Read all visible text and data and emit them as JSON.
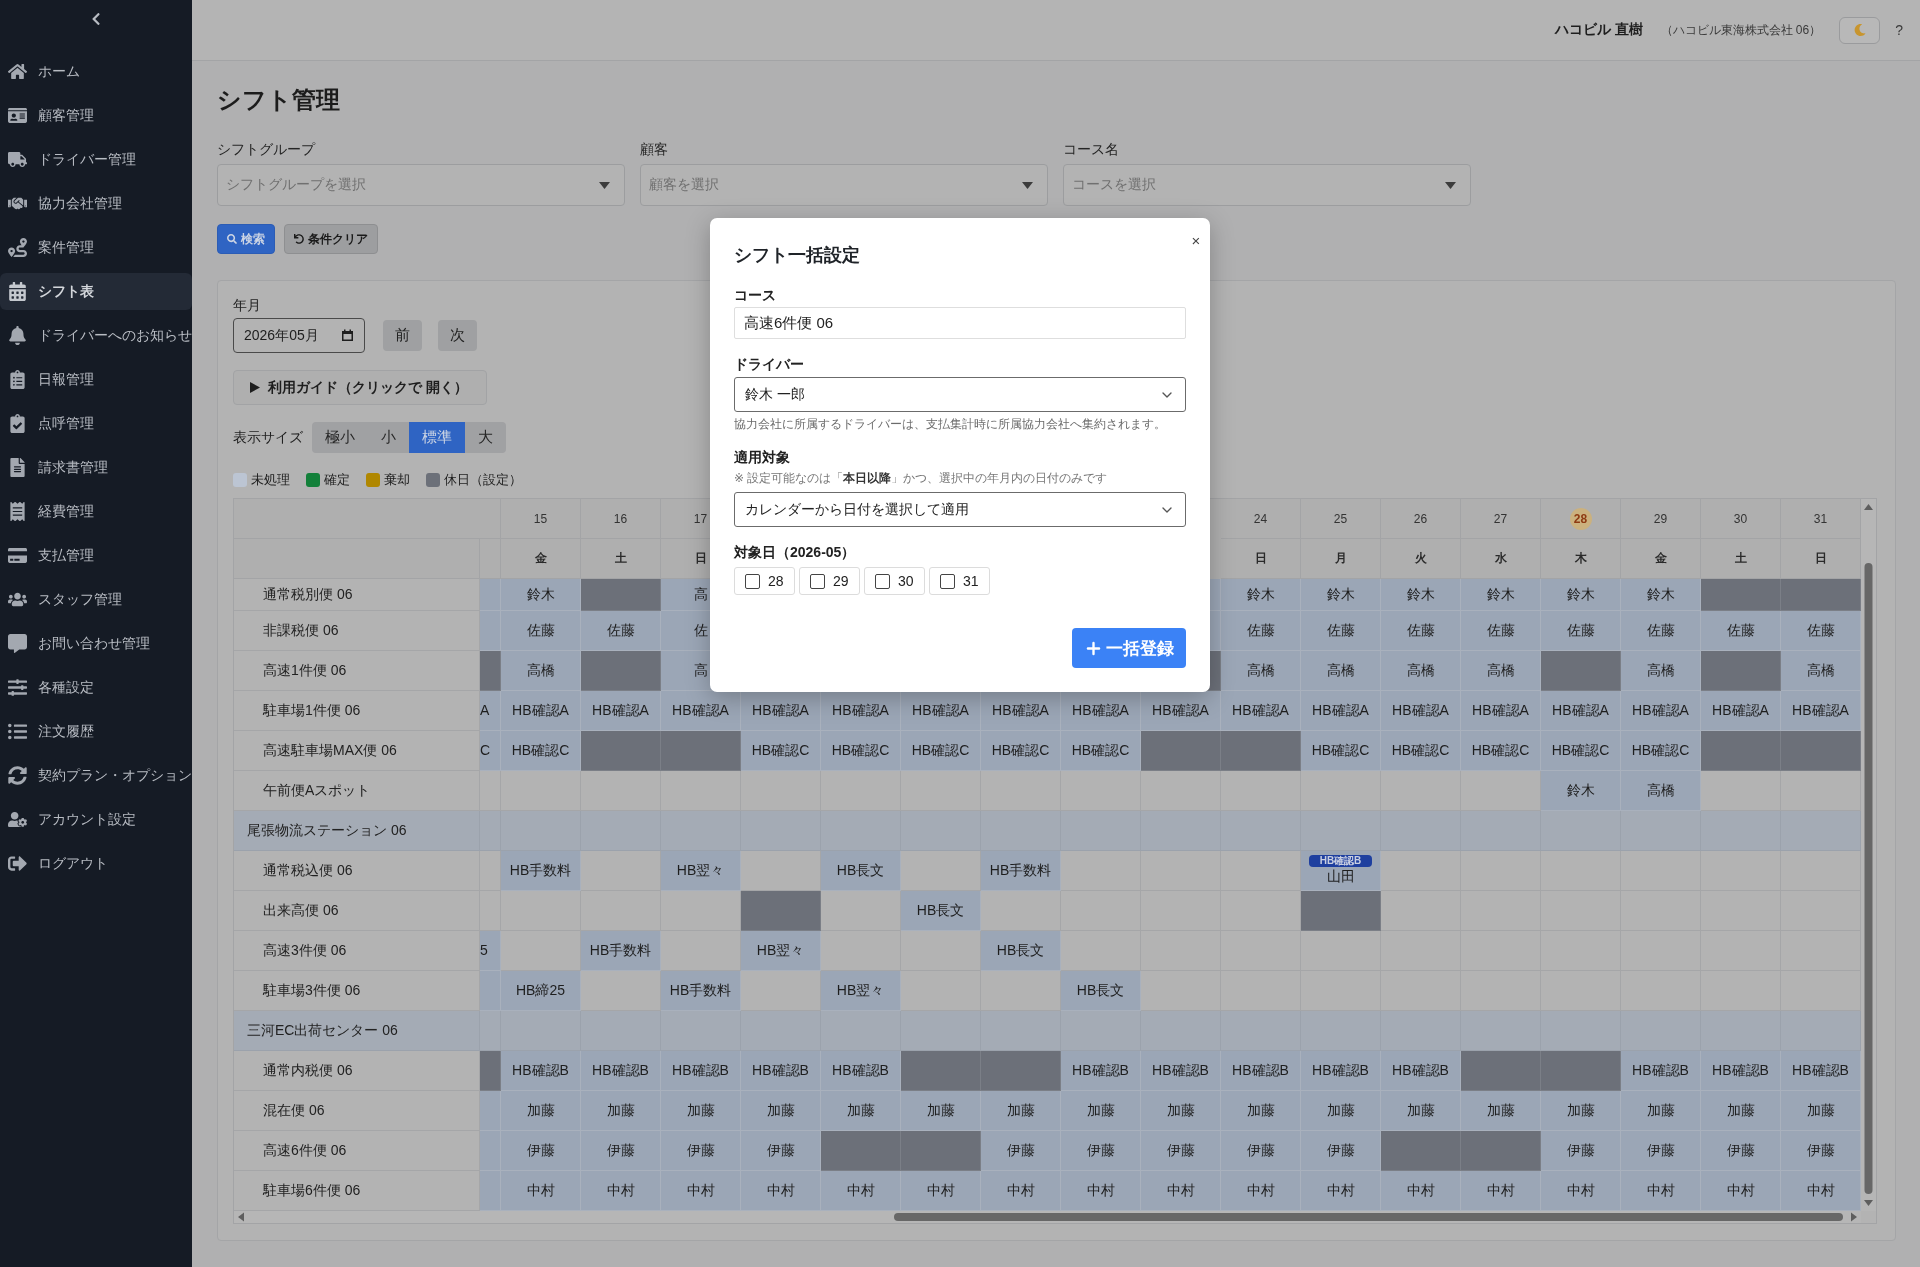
{
  "sidebar": {
    "items": [
      {
        "label": "ホーム",
        "selected": false
      },
      {
        "label": "顧客管理",
        "selected": false
      },
      {
        "label": "ドライバー管理",
        "selected": false
      },
      {
        "label": "協力会社管理",
        "selected": false
      },
      {
        "label": "案件管理",
        "selected": false
      },
      {
        "label": "シフト表",
        "selected": true
      },
      {
        "label": "ドライバーへのお知らせ",
        "selected": false
      },
      {
        "label": "日報管理",
        "selected": false
      },
      {
        "label": "点呼管理",
        "selected": false
      },
      {
        "label": "請求書管理",
        "selected": false
      },
      {
        "label": "経費管理",
        "selected": false
      },
      {
        "label": "支払管理",
        "selected": false
      },
      {
        "label": "スタッフ管理",
        "selected": false
      },
      {
        "label": "お問い合わせ管理",
        "selected": false
      },
      {
        "label": "各種設定",
        "selected": false
      },
      {
        "label": "注文履歴",
        "selected": false
      },
      {
        "label": "契約プラン・オプション",
        "selected": false
      },
      {
        "label": "アカウント設定",
        "selected": false
      },
      {
        "label": "ログアウト",
        "selected": false
      }
    ]
  },
  "topbar": {
    "user_name": "ハコビル 直樹",
    "company": "（ハコビル東海株式会社 06）",
    "help": "?"
  },
  "page": {
    "title": "シフト管理"
  },
  "filters": [
    {
      "label": "シフトグループ",
      "placeholder": "シフトグループを選択"
    },
    {
      "label": "顧客",
      "placeholder": "顧客を選択"
    },
    {
      "label": "コース名",
      "placeholder": "コースを選択"
    }
  ],
  "actions": [
    {
      "label": "検索",
      "kind": "primary"
    },
    {
      "label": "条件クリア",
      "kind": "secondary"
    }
  ],
  "month": {
    "label": "年月",
    "value": "2026年05月",
    "prev": "前",
    "next": "次"
  },
  "guide": {
    "label": "利用ガイド（クリックで 開く）",
    "expanded": false
  },
  "size": {
    "label": "表示サイズ",
    "options": [
      {
        "label": "極小",
        "selected": false
      },
      {
        "label": "小",
        "selected": false
      },
      {
        "label": "標準",
        "selected": true
      },
      {
        "label": "大",
        "selected": false
      }
    ]
  },
  "legend": [
    {
      "label": "未処理",
      "color": "#bcc5d3"
    },
    {
      "label": "確定",
      "color": "#13803a"
    },
    {
      "label": "棄却",
      "color": "#b08700"
    },
    {
      "label": "休日（設定）",
      "color": "#6c7079"
    }
  ],
  "table": {
    "days": [
      {
        "kind": "partial"
      },
      {
        "kind": "day",
        "day": "15",
        "weekday": "金",
        "today": false
      },
      {
        "kind": "day",
        "day": "16",
        "weekday": "土",
        "today": false
      },
      {
        "kind": "day",
        "day": "17",
        "weekday": "日",
        "today": false
      },
      {
        "kind": "covered"
      },
      {
        "kind": "covered"
      },
      {
        "kind": "covered"
      },
      {
        "kind": "covered"
      },
      {
        "kind": "covered"
      },
      {
        "kind": "covered"
      },
      {
        "kind": "day",
        "day": "24",
        "weekday": "日",
        "today": false
      },
      {
        "kind": "day",
        "day": "25",
        "weekday": "月",
        "today": false
      },
      {
        "kind": "day",
        "day": "26",
        "weekday": "火",
        "today": false
      },
      {
        "kind": "day",
        "day": "27",
        "weekday": "水",
        "today": false
      },
      {
        "kind": "day",
        "day": "28",
        "weekday": "木",
        "today": true
      },
      {
        "kind": "day",
        "day": "29",
        "weekday": "金",
        "today": false
      },
      {
        "kind": "day",
        "day": "30",
        "weekday": "土",
        "today": false
      },
      {
        "kind": "day",
        "day": "31",
        "weekday": "日",
        "today": false
      }
    ],
    "rows": [
      {
        "kind": "course",
        "label": "通常税別便 06",
        "cells": [
          {
            "kind": "pending"
          },
          {
            "kind": "pending",
            "text": "鈴木"
          },
          {
            "kind": "holiday"
          },
          {
            "kind": "pending",
            "text": "高"
          },
          {
            "kind": "covered"
          },
          {
            "kind": "covered"
          },
          {
            "kind": "covered"
          },
          {
            "kind": "covered"
          },
          {
            "kind": "covered"
          },
          {
            "kind": "pending"
          },
          {
            "kind": "pending",
            "text": "鈴木"
          },
          {
            "kind": "pending",
            "text": "鈴木"
          },
          {
            "kind": "pending",
            "text": "鈴木"
          },
          {
            "kind": "pending",
            "text": "鈴木"
          },
          {
            "kind": "pending",
            "text": "鈴木"
          },
          {
            "kind": "pending",
            "text": "鈴木"
          },
          {
            "kind": "holiday"
          },
          {
            "kind": "holiday"
          }
        ]
      },
      {
        "kind": "course",
        "label": "非課税便 06",
        "cells": [
          {
            "kind": "pending"
          },
          {
            "kind": "pending",
            "text": "佐藤"
          },
          {
            "kind": "pending",
            "text": "佐藤"
          },
          {
            "kind": "pending",
            "text": "佐"
          },
          {
            "kind": "covered"
          },
          {
            "kind": "covered"
          },
          {
            "kind": "covered"
          },
          {
            "kind": "covered"
          },
          {
            "kind": "covered"
          },
          {
            "kind": "pending"
          },
          {
            "kind": "pending",
            "text": "佐藤"
          },
          {
            "kind": "pending",
            "text": "佐藤"
          },
          {
            "kind": "pending",
            "text": "佐藤"
          },
          {
            "kind": "pending",
            "text": "佐藤"
          },
          {
            "kind": "pending",
            "text": "佐藤"
          },
          {
            "kind": "pending",
            "text": "佐藤"
          },
          {
            "kind": "pending",
            "text": "佐藤"
          },
          {
            "kind": "pending",
            "text": "佐藤"
          }
        ]
      },
      {
        "kind": "course",
        "label": "高速1件便 06",
        "cells": [
          {
            "kind": "holiday"
          },
          {
            "kind": "pending",
            "text": "高橋"
          },
          {
            "kind": "holiday"
          },
          {
            "kind": "pending",
            "text": "高"
          },
          {
            "kind": "covered"
          },
          {
            "kind": "covered"
          },
          {
            "kind": "covered"
          },
          {
            "kind": "covered"
          },
          {
            "kind": "covered"
          },
          {
            "kind": "holiday"
          },
          {
            "kind": "pending",
            "text": "高橋"
          },
          {
            "kind": "pending",
            "text": "高橋"
          },
          {
            "kind": "pending",
            "text": "高橋"
          },
          {
            "kind": "pending",
            "text": "高橋"
          },
          {
            "kind": "holiday"
          },
          {
            "kind": "pending",
            "text": "高橋"
          },
          {
            "kind": "holiday"
          },
          {
            "kind": "pending",
            "text": "高橋"
          }
        ]
      },
      {
        "kind": "course",
        "label": "駐車場1件便 06",
        "cells": [
          {
            "kind": "pending",
            "text": "A"
          },
          {
            "kind": "pending",
            "text": "HB確認A"
          },
          {
            "kind": "pending",
            "text": "HB確認A"
          },
          {
            "kind": "pending",
            "text": "HB確認A"
          },
          {
            "kind": "pending",
            "text": "HB確認A"
          },
          {
            "kind": "pending",
            "text": "HB確認A"
          },
          {
            "kind": "pending",
            "text": "HB確認A"
          },
          {
            "kind": "pending",
            "text": "HB確認A"
          },
          {
            "kind": "pending",
            "text": "HB確認A"
          },
          {
            "kind": "pending",
            "text": "HB確認A"
          },
          {
            "kind": "pending",
            "text": "HB確認A"
          },
          {
            "kind": "pending",
            "text": "HB確認A"
          },
          {
            "kind": "pending",
            "text": "HB確認A"
          },
          {
            "kind": "pending",
            "text": "HB確認A"
          },
          {
            "kind": "pending",
            "text": "HB確認A"
          },
          {
            "kind": "pending",
            "text": "HB確認A"
          },
          {
            "kind": "pending",
            "text": "HB確認A"
          },
          {
            "kind": "pending",
            "text": "HB確認A"
          }
        ]
      },
      {
        "kind": "course",
        "label": "高速駐車場MAX便 06",
        "cells": [
          {
            "kind": "pending",
            "text": "C"
          },
          {
            "kind": "pending",
            "text": "HB確認C"
          },
          {
            "kind": "holiday"
          },
          {
            "kind": "holiday"
          },
          {
            "kind": "pending",
            "text": "HB確認C"
          },
          {
            "kind": "pending",
            "text": "HB確認C"
          },
          {
            "kind": "pending",
            "text": "HB確認C"
          },
          {
            "kind": "pending",
            "text": "HB確認C"
          },
          {
            "kind": "pending",
            "text": "HB確認C"
          },
          {
            "kind": "holiday"
          },
          {
            "kind": "holiday"
          },
          {
            "kind": "pending",
            "text": "HB確認C"
          },
          {
            "kind": "pending",
            "text": "HB確認C"
          },
          {
            "kind": "pending",
            "text": "HB確認C"
          },
          {
            "kind": "pending",
            "text": "HB確認C"
          },
          {
            "kind": "pending",
            "text": "HB確認C"
          },
          {
            "kind": "holiday"
          },
          {
            "kind": "holiday"
          }
        ]
      },
      {
        "kind": "course",
        "label": "午前便Aスポット",
        "cells": [
          {
            "kind": "empty"
          },
          {
            "kind": "empty"
          },
          {
            "kind": "empty"
          },
          {
            "kind": "empty"
          },
          {
            "kind": "empty"
          },
          {
            "kind": "empty"
          },
          {
            "kind": "empty"
          },
          {
            "kind": "empty"
          },
          {
            "kind": "empty"
          },
          {
            "kind": "empty"
          },
          {
            "kind": "empty"
          },
          {
            "kind": "empty"
          },
          {
            "kind": "empty"
          },
          {
            "kind": "empty"
          },
          {
            "kind": "pending",
            "text": "鈴木"
          },
          {
            "kind": "pending",
            "text": "高橋"
          },
          {
            "kind": "empty"
          },
          {
            "kind": "empty"
          }
        ]
      },
      {
        "kind": "group",
        "label": "尾張物流ステーション 06"
      },
      {
        "kind": "course",
        "label": "通常税込便 06",
        "cells": [
          {
            "kind": "empty"
          },
          {
            "kind": "pending",
            "text": "HB手数料"
          },
          {
            "kind": "empty"
          },
          {
            "kind": "pending",
            "text": "HB翌々"
          },
          {
            "kind": "empty"
          },
          {
            "kind": "pending",
            "text": "HB長文"
          },
          {
            "kind": "empty"
          },
          {
            "kind": "pending",
            "text": "HB手数料"
          },
          {
            "kind": "empty"
          },
          {
            "kind": "empty"
          },
          {
            "kind": "empty"
          },
          {
            "kind": "pending",
            "tag": "HB確認B",
            "text": "山田"
          },
          {
            "kind": "empty"
          },
          {
            "kind": "empty"
          },
          {
            "kind": "empty"
          },
          {
            "kind": "empty"
          },
          {
            "kind": "empty"
          },
          {
            "kind": "empty"
          }
        ]
      },
      {
        "kind": "course",
        "label": "出来高便 06",
        "cells": [
          {
            "kind": "empty"
          },
          {
            "kind": "empty"
          },
          {
            "kind": "empty"
          },
          {
            "kind": "empty"
          },
          {
            "kind": "holiday"
          },
          {
            "kind": "empty"
          },
          {
            "kind": "pending",
            "text": "HB長文"
          },
          {
            "kind": "empty"
          },
          {
            "kind": "empty"
          },
          {
            "kind": "empty"
          },
          {
            "kind": "empty"
          },
          {
            "kind": "holiday"
          },
          {
            "kind": "empty"
          },
          {
            "kind": "empty"
          },
          {
            "kind": "empty"
          },
          {
            "kind": "empty"
          },
          {
            "kind": "empty"
          },
          {
            "kind": "empty"
          }
        ]
      },
      {
        "kind": "course",
        "label": "高速3件便 06",
        "cells": [
          {
            "kind": "pending",
            "text": "5"
          },
          {
            "kind": "empty"
          },
          {
            "kind": "pending",
            "text": "HB手数料"
          },
          {
            "kind": "empty"
          },
          {
            "kind": "pending",
            "text": "HB翌々"
          },
          {
            "kind": "empty"
          },
          {
            "kind": "empty"
          },
          {
            "kind": "pending",
            "text": "HB長文"
          },
          {
            "kind": "empty"
          },
          {
            "kind": "empty"
          },
          {
            "kind": "empty"
          },
          {
            "kind": "empty"
          },
          {
            "kind": "empty"
          },
          {
            "kind": "empty"
          },
          {
            "kind": "empty"
          },
          {
            "kind": "empty"
          },
          {
            "kind": "empty"
          },
          {
            "kind": "empty"
          }
        ]
      },
      {
        "kind": "course",
        "label": "駐車場3件便 06",
        "cells": [
          {
            "kind": "pending"
          },
          {
            "kind": "pending",
            "text": "HB締25"
          },
          {
            "kind": "empty"
          },
          {
            "kind": "pending",
            "text": "HB手数料"
          },
          {
            "kind": "empty"
          },
          {
            "kind": "pending",
            "text": "HB翌々"
          },
          {
            "kind": "empty"
          },
          {
            "kind": "empty"
          },
          {
            "kind": "pending",
            "text": "HB長文"
          },
          {
            "kind": "empty"
          },
          {
            "kind": "empty"
          },
          {
            "kind": "empty"
          },
          {
            "kind": "empty"
          },
          {
            "kind": "empty"
          },
          {
            "kind": "empty"
          },
          {
            "kind": "empty"
          },
          {
            "kind": "empty"
          },
          {
            "kind": "empty"
          }
        ]
      },
      {
        "kind": "group",
        "label": "三河EC出荷センター 06"
      },
      {
        "kind": "course",
        "label": "通常内税便 06",
        "cells": [
          {
            "kind": "holiday"
          },
          {
            "kind": "pending",
            "text": "HB確認B"
          },
          {
            "kind": "pending",
            "text": "HB確認B"
          },
          {
            "kind": "pending",
            "text": "HB確認B"
          },
          {
            "kind": "pending",
            "text": "HB確認B"
          },
          {
            "kind": "pending",
            "text": "HB確認B"
          },
          {
            "kind": "holiday"
          },
          {
            "kind": "holiday"
          },
          {
            "kind": "pending",
            "text": "HB確認B"
          },
          {
            "kind": "pending",
            "text": "HB確認B"
          },
          {
            "kind": "pending",
            "text": "HB確認B"
          },
          {
            "kind": "pending",
            "text": "HB確認B"
          },
          {
            "kind": "pending",
            "text": "HB確認B"
          },
          {
            "kind": "holiday"
          },
          {
            "kind": "holiday"
          },
          {
            "kind": "pending",
            "text": "HB確認B"
          },
          {
            "kind": "pending",
            "text": "HB確認B"
          },
          {
            "kind": "pending",
            "text": "HB確認B"
          }
        ]
      },
      {
        "kind": "course",
        "label": "混在便 06",
        "cells": [
          {
            "kind": "pending"
          },
          {
            "kind": "pending",
            "text": "加藤"
          },
          {
            "kind": "pending",
            "text": "加藤"
          },
          {
            "kind": "pending",
            "text": "加藤"
          },
          {
            "kind": "pending",
            "text": "加藤"
          },
          {
            "kind": "pending",
            "text": "加藤"
          },
          {
            "kind": "pending",
            "text": "加藤"
          },
          {
            "kind": "pending",
            "text": "加藤"
          },
          {
            "kind": "pending",
            "text": "加藤"
          },
          {
            "kind": "pending",
            "text": "加藤"
          },
          {
            "kind": "pending",
            "text": "加藤"
          },
          {
            "kind": "pending",
            "text": "加藤"
          },
          {
            "kind": "pending",
            "text": "加藤"
          },
          {
            "kind": "pending",
            "text": "加藤"
          },
          {
            "kind": "pending",
            "text": "加藤"
          },
          {
            "kind": "pending",
            "text": "加藤"
          },
          {
            "kind": "pending",
            "text": "加藤"
          },
          {
            "kind": "pending",
            "text": "加藤"
          }
        ]
      },
      {
        "kind": "course",
        "label": "高速6件便 06",
        "cells": [
          {
            "kind": "pending"
          },
          {
            "kind": "pending",
            "text": "伊藤"
          },
          {
            "kind": "pending",
            "text": "伊藤"
          },
          {
            "kind": "pending",
            "text": "伊藤"
          },
          {
            "kind": "pending",
            "text": "伊藤"
          },
          {
            "kind": "holiday"
          },
          {
            "kind": "holiday"
          },
          {
            "kind": "pending",
            "text": "伊藤"
          },
          {
            "kind": "pending",
            "text": "伊藤"
          },
          {
            "kind": "pending",
            "text": "伊藤"
          },
          {
            "kind": "pending",
            "text": "伊藤"
          },
          {
            "kind": "pending",
            "text": "伊藤"
          },
          {
            "kind": "holiday"
          },
          {
            "kind": "holiday"
          },
          {
            "kind": "pending",
            "text": "伊藤"
          },
          {
            "kind": "pending",
            "text": "伊藤"
          },
          {
            "kind": "pending",
            "text": "伊藤"
          },
          {
            "kind": "pending",
            "text": "伊藤"
          }
        ]
      },
      {
        "kind": "course",
        "label": "駐車場6件便 06",
        "cells": [
          {
            "kind": "pending"
          },
          {
            "kind": "pending",
            "text": "中村"
          },
          {
            "kind": "pending",
            "text": "中村"
          },
          {
            "kind": "pending",
            "text": "中村"
          },
          {
            "kind": "pending",
            "text": "中村"
          },
          {
            "kind": "pending",
            "text": "中村"
          },
          {
            "kind": "pending",
            "text": "中村"
          },
          {
            "kind": "pending",
            "text": "中村"
          },
          {
            "kind": "pending",
            "text": "中村"
          },
          {
            "kind": "pending",
            "text": "中村"
          },
          {
            "kind": "pending",
            "text": "中村"
          },
          {
            "kind": "pending",
            "text": "中村"
          },
          {
            "kind": "pending",
            "text": "中村"
          },
          {
            "kind": "pending",
            "text": "中村"
          },
          {
            "kind": "pending",
            "text": "中村"
          },
          {
            "kind": "pending",
            "text": "中村"
          },
          {
            "kind": "pending",
            "text": "中村"
          },
          {
            "kind": "pending",
            "text": "中村"
          }
        ]
      }
    ]
  },
  "modal": {
    "title": "シフト一括設定",
    "close": "×",
    "course": {
      "label": "コース",
      "value": "高速6件便 06"
    },
    "driver": {
      "label": "ドライバー",
      "value": "鈴木 一郎",
      "hint": "協力会社に所属するドライバーは、支払集計時に所属協力会社へ集約されます。"
    },
    "target": {
      "label": "適用対象",
      "note": "※ 設定可能なのは「**本日以降**」かつ、選択中の年月内の日付のみです",
      "value": "カレンダーから日付を選択して適用"
    },
    "dates": {
      "label": "対象日（2026-05）",
      "options": [
        {
          "label": "28",
          "checked": false
        },
        {
          "label": "29",
          "checked": false
        },
        {
          "label": "30",
          "checked": false
        },
        {
          "label": "31",
          "checked": false
        }
      ]
    },
    "submit": "一括登録"
  }
}
